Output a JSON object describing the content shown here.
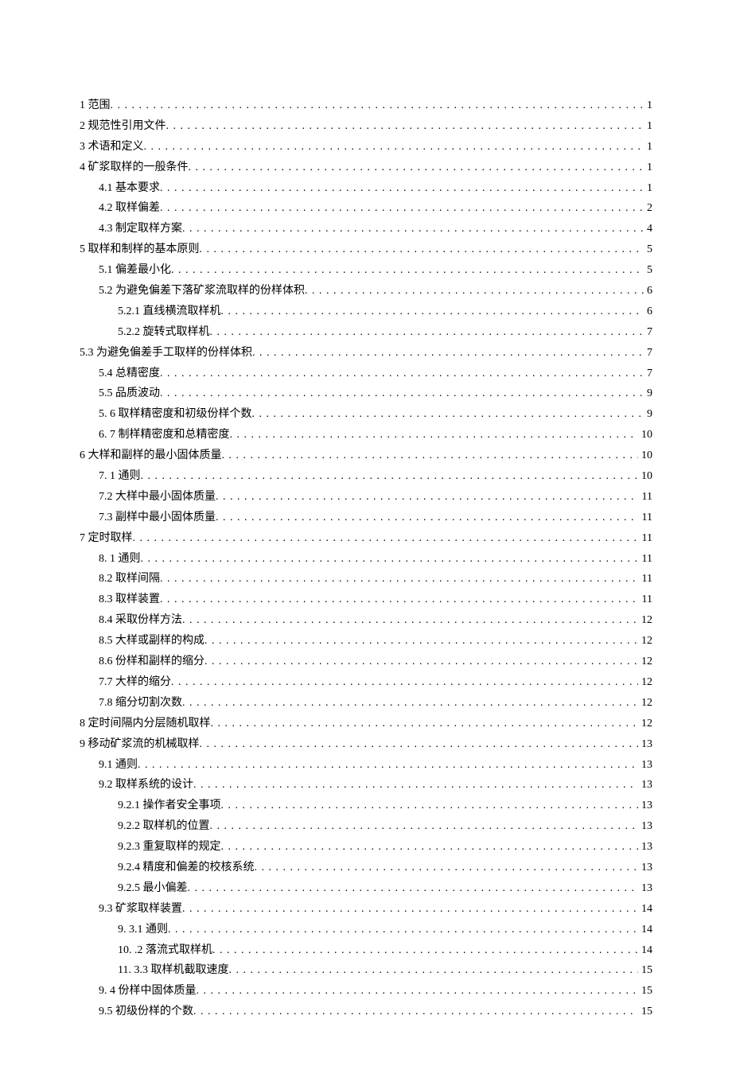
{
  "toc": [
    {
      "label": "1 范围",
      "page": "1",
      "level": 0
    },
    {
      "label": "2 规范性引用文件",
      "page": "1",
      "level": 0
    },
    {
      "label": "3 术语和定义",
      "page": "1",
      "level": 0
    },
    {
      "label": "4 矿浆取样的一般条件",
      "page": "1",
      "level": 0
    },
    {
      "label": "4.1 基本要求",
      "page": "1",
      "level": 1
    },
    {
      "label": "4.2 取样偏差",
      "page": "2",
      "level": 1
    },
    {
      "label": "4.3 制定取样方案",
      "page": "4",
      "level": 1
    },
    {
      "label": "5 取样和制样的基本原则",
      "page": "5",
      "level": 0
    },
    {
      "label": "5.1 偏差最小化",
      "page": "5",
      "level": 1
    },
    {
      "label": "5.2 为避免偏差下落矿浆流取样的份样体积",
      "page": "6",
      "level": 1
    },
    {
      "label": "5.2.1 直线横流取样机",
      "page": "6",
      "level": 2
    },
    {
      "label": "5.2.2 旋转式取样机",
      "page": "7",
      "level": 2
    },
    {
      "label": "5.3 为避免偏差手工取样的份样体积",
      "page": "7",
      "level": 0
    },
    {
      "label": "5.4 总精密度",
      "page": "7",
      "level": 1
    },
    {
      "label": "5.5 品质波动",
      "page": "9",
      "level": 1
    },
    {
      "label": "5.    6 取样精密度和初级份样个数",
      "page": "9",
      "level": 1
    },
    {
      "label": "6.    7 制样精密度和总精密度",
      "page": "10",
      "level": 1
    },
    {
      "label": "6 大样和副样的最小固体质量",
      "page": "10",
      "level": 0
    },
    {
      "label": "7.    1 通则",
      "page": "10",
      "level": 1
    },
    {
      "label": "7.2      大样中最小固体质量",
      "page": "11",
      "level": 1
    },
    {
      "label": "7.3      副样中最小固体质量",
      "page": "11",
      "level": 1
    },
    {
      "label": "7 定时取样",
      "page": "11",
      "level": 0
    },
    {
      "label": "8.    1 通则",
      "page": "11",
      "level": 1
    },
    {
      "label": "8.2      取样间隔",
      "page": "11",
      "level": 1
    },
    {
      "label": "8.3      取样装置",
      "page": "11",
      "level": 1
    },
    {
      "label": "8.4      采取份样方法",
      "page": "12",
      "level": 1
    },
    {
      "label": "8.5      大样或副样的构成",
      "page": "12",
      "level": 1
    },
    {
      "label": "8.6      份样和副样的缩分",
      "page": "12",
      "level": 1
    },
    {
      "label": "7.7 大样的缩分",
      "page": "12",
      "level": 1
    },
    {
      "label": "7.8 缩分切割次数",
      "page": "12",
      "level": 1
    },
    {
      "label": "8 定时间隔内分层随机取样",
      "page": "12",
      "level": 0
    },
    {
      "label": "9 移动矿浆流的机械取样",
      "page": "13",
      "level": 0
    },
    {
      "label": "9.1 通则",
      "page": "13",
      "level": 1
    },
    {
      "label": "9.2 取样系统的设计",
      "page": "13",
      "level": 1
    },
    {
      "label": "9.2.1 操作者安全事项",
      "page": "13",
      "level": 2
    },
    {
      "label": "9.2.2 取样机的位置",
      "page": "13",
      "level": 2
    },
    {
      "label": "9.2.3 重复取样的规定",
      "page": "13",
      "level": 2
    },
    {
      "label": "9.2.4 精度和偏差的校核系统",
      "page": "13",
      "level": 2
    },
    {
      "label": "9.2.5 最小偏差",
      "page": "13",
      "level": 2
    },
    {
      "label": "9.3 矿浆取样装置",
      "page": "14",
      "level": 1
    },
    {
      "label": "9.    3.1 通则",
      "page": "14",
      "level": 2
    },
    {
      "label": "10.    .2 落流式取样机",
      "page": "14",
      "level": 2
    },
    {
      "label": "11. 3.3 取样机截取速度",
      "page": "15",
      "level": 2
    },
    {
      "label": "9.    4 份样中固体质量",
      "page": "15",
      "level": 1
    },
    {
      "label": "9.5      初级份样的个数",
      "page": "15",
      "level": 1
    }
  ]
}
